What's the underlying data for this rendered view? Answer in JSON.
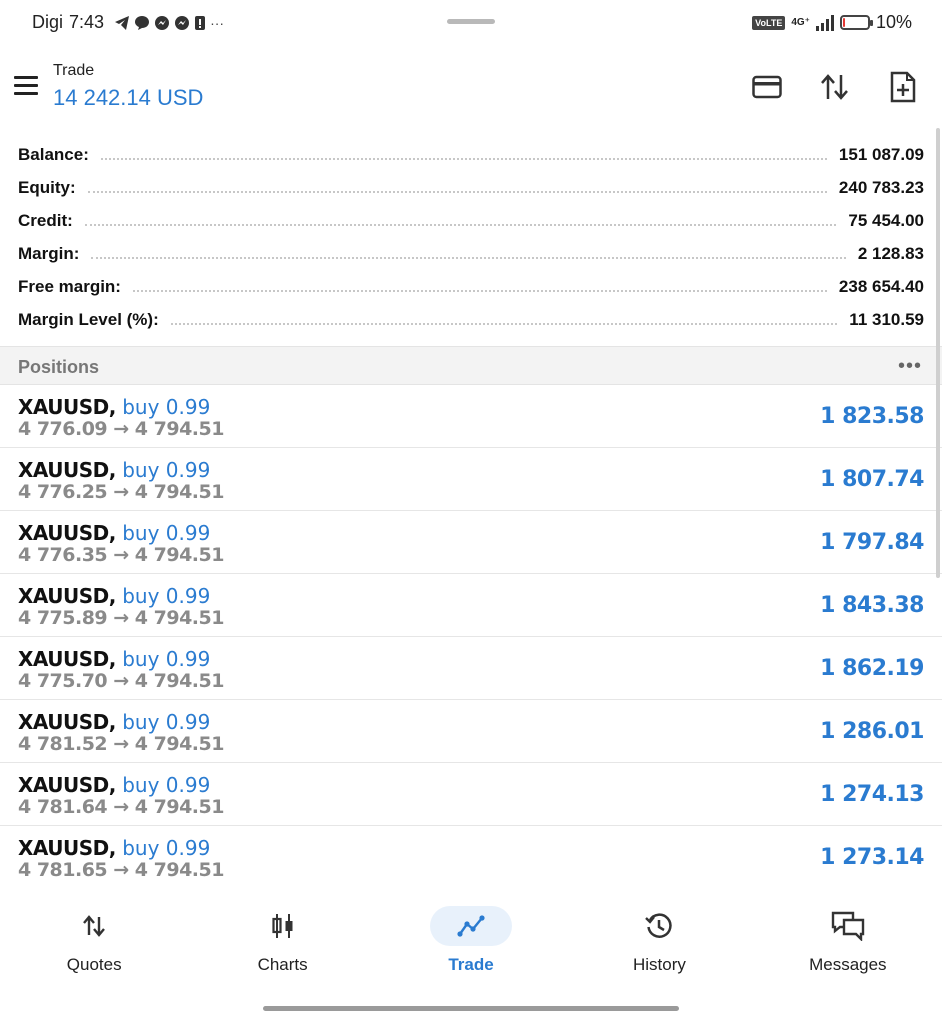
{
  "status_bar": {
    "carrier": "Digi",
    "time": "7:43",
    "network": "4G⁺",
    "volte": "VoLTE",
    "battery_percent": "10%",
    "battery_level": 0.1
  },
  "header": {
    "title": "Trade",
    "balance": "14 242.14 USD"
  },
  "summary": [
    {
      "label": "Balance:",
      "value": "151 087.09"
    },
    {
      "label": "Equity:",
      "value": "240 783.23"
    },
    {
      "label": "Credit:",
      "value": "75 454.00"
    },
    {
      "label": "Margin:",
      "value": "2 128.83"
    },
    {
      "label": "Free margin:",
      "value": "238 654.40"
    },
    {
      "label": "Margin Level (%):",
      "value": "11 310.59"
    }
  ],
  "positions": {
    "title": "Positions",
    "more": "•••",
    "items": [
      {
        "symbol": "XAUUSD,",
        "side": "buy 0.99",
        "prices": "4 776.09 → 4 794.51",
        "profit": "1 823.58"
      },
      {
        "symbol": "XAUUSD,",
        "side": "buy 0.99",
        "prices": "4 776.25 → 4 794.51",
        "profit": "1 807.74"
      },
      {
        "symbol": "XAUUSD,",
        "side": "buy 0.99",
        "prices": "4 776.35 → 4 794.51",
        "profit": "1 797.84"
      },
      {
        "symbol": "XAUUSD,",
        "side": "buy 0.99",
        "prices": "4 775.89 → 4 794.51",
        "profit": "1 843.38"
      },
      {
        "symbol": "XAUUSD,",
        "side": "buy 0.99",
        "prices": "4 775.70 → 4 794.51",
        "profit": "1 862.19"
      },
      {
        "symbol": "XAUUSD,",
        "side": "buy 0.99",
        "prices": "4 781.52 → 4 794.51",
        "profit": "1 286.01"
      },
      {
        "symbol": "XAUUSD,",
        "side": "buy 0.99",
        "prices": "4 781.64 → 4 794.51",
        "profit": "1 274.13"
      },
      {
        "symbol": "XAUUSD,",
        "side": "buy 0.99",
        "prices": "4 781.65 → 4 794.51",
        "profit": "1 273.14"
      }
    ]
  },
  "bottom_nav": [
    {
      "label": "Quotes",
      "icon": "quotes-arrows-icon"
    },
    {
      "label": "Charts",
      "icon": "candlestick-icon"
    },
    {
      "label": "Trade",
      "icon": "trend-line-icon"
    },
    {
      "label": "History",
      "icon": "history-icon"
    },
    {
      "label": "Messages",
      "icon": "messages-icon"
    }
  ],
  "active_tab": "Trade",
  "colors": {
    "accent": "#2a7bd0",
    "muted": "#8a8a8a",
    "section_bg": "#f3f3f3"
  }
}
